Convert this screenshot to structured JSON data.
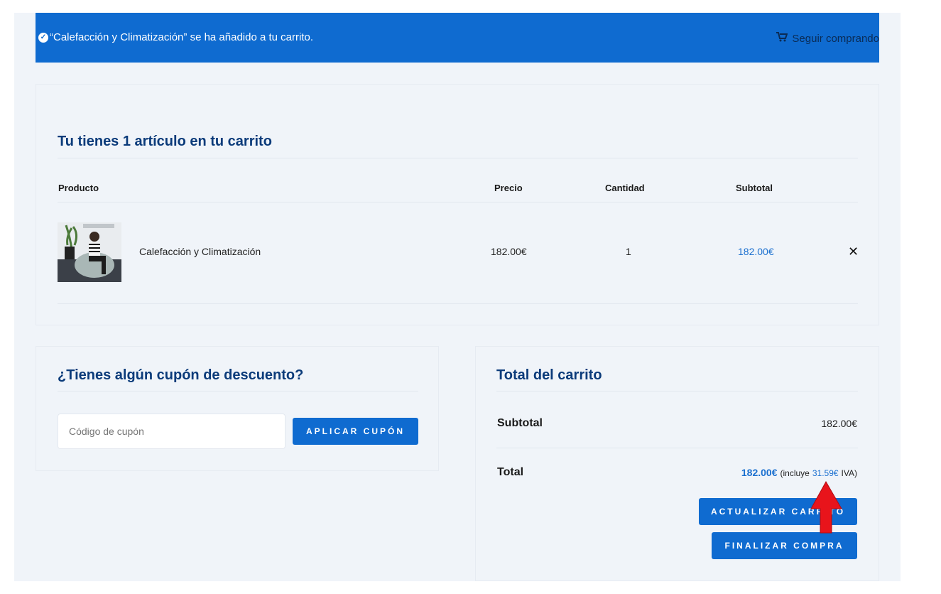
{
  "notice": {
    "message": "“Calefacción y Climatización” se ha añadido a tu carrito.",
    "continue_label": "Seguir comprando",
    "icon": "check-circle-icon",
    "cart_icon": "cart-icon"
  },
  "cart": {
    "heading": "Tu tienes 1 artículo en tu carrito",
    "columns": [
      "Producto",
      "Precio",
      "Cantidad",
      "Subtotal"
    ],
    "items": [
      {
        "name": "Calefacción y Climatización",
        "price": "182.00€",
        "quantity": "1",
        "subtotal": "182.00€"
      }
    ]
  },
  "coupon": {
    "heading": "¿Tienes algún cupón de descuento?",
    "placeholder": "Código de cupón",
    "apply_label": "APLICAR CUPÓN"
  },
  "totals": {
    "heading": "Total del carrito",
    "subtotal_label": "Subtotal",
    "subtotal_value": "182.00€",
    "total_label": "Total",
    "total_value": "182.00€",
    "tax_prefix": "(incluye",
    "tax_value": "31.59€",
    "tax_suffix": "IVA)",
    "update_label": "ACTUALIZAR CARRITO",
    "checkout_label": "FINALIZAR COMPRA"
  },
  "colors": {
    "accent": "#0f6bd0",
    "heading": "#0b3b7a",
    "background": "#f0f4f9",
    "annotation_arrow": "#e8141b"
  }
}
